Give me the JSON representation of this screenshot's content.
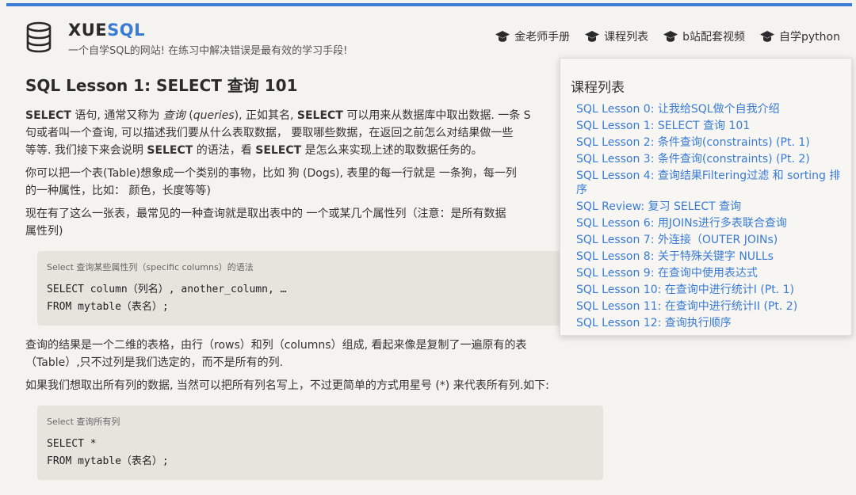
{
  "header": {
    "brand_part1": "XUE",
    "brand_part2": "SQL",
    "tagline": "一个自学SQL的网站! 在练习中解决错误是最有效的学习手段!",
    "nav": [
      {
        "label": "金老师手册",
        "icon": "graduation-cap-icon"
      },
      {
        "label": "课程列表",
        "icon": "graduation-cap-icon"
      },
      {
        "label": "b站配套视频",
        "icon": "graduation-cap-icon"
      },
      {
        "label": "自学python",
        "icon": "graduation-cap-icon"
      }
    ]
  },
  "colors": {
    "accent": "#3a7bd5",
    "background": "#f4f3ef",
    "code_bg": "#e6e4dd"
  },
  "lesson": {
    "title": "SQL Lesson 1: SELECT 查询 101",
    "p1": [
      {
        "t": "SELECT",
        "s": "b"
      },
      {
        "t": " 语句, 通常又称为 "
      },
      {
        "t": "查询",
        "s": "i"
      },
      {
        "t": " ("
      },
      {
        "t": "queries",
        "s": "i"
      },
      {
        "t": "), 正如其名, "
      },
      {
        "t": "SELECT",
        "s": "b"
      },
      {
        "t": " 可以用来从数据库中取出数据. 一条 S"
      },
      {
        "t": "",
        "s": "br"
      },
      {
        "t": "句或者叫一个查询, 可以描述我们要从什么表取数据， 要取哪些数据，在返回之前怎么对结果做一些"
      },
      {
        "t": "",
        "s": "br"
      },
      {
        "t": "等等. 我们接下来会说明 "
      },
      {
        "t": "SELECT",
        "s": "b"
      },
      {
        "t": " 的语法，看 "
      },
      {
        "t": "SELECT",
        "s": "b"
      },
      {
        "t": " 是怎么来实现上述的取数据任务的。"
      }
    ],
    "p2_line1": "你可以把一个表(Table)想象成一个类别的事物，比如 狗 (Dogs), 表里的每一行就是 一条狗，每一列",
    "p2_line2": "的一种属性，比如： 颜色，长度等等)",
    "p3_line1": "现在有了这么一张表，最常见的一种查询就是取出表中的 一个或某几个属性列（注意：是所有数据",
    "p3_line2": "属性列)",
    "code1": {
      "caption": "Select 查询某些属性列（specific columns）的语法",
      "line1": "SELECT column（列名）, another_column, …",
      "line2": "FROM mytable（表名）;"
    },
    "p4_line1": "查询的结果是一个二维的表格，由行（rows）和列（columns）组成, 看起来像是复制了一遍原有的表",
    "p4_line2": "（Table）,只不过列是我们选定的，而不是所有的列.",
    "p5": "如果我们想取出所有列的数据, 当然可以把所有列名写上，不过更简单的方式用星号 (*) 来代表所有列.如下:",
    "code2": {
      "caption": "Select 查询所有列",
      "line1": "SELECT *",
      "line2": "FROM mytable（表名）;"
    }
  },
  "dropdown": {
    "title": "课程列表",
    "items": [
      "SQL Lesson 0: 让我给SQL做个自我介绍",
      "SQL Lesson 1: SELECT 查询 101",
      "SQL Lesson 2: 条件查询(constraints) (Pt. 1)",
      "SQL Lesson 3: 条件查询(constraints) (Pt. 2)",
      "SQL Lesson 4: 查询结果Filtering过滤 和 sorting 排序",
      "SQL Review: 复习 SELECT 查询",
      "SQL Lesson 6: 用JOINs进行多表联合查询",
      "SQL Lesson 7: 外连接（OUTER JOINs)",
      "SQL Lesson 8: 关于特殊关键字 NULLs",
      "SQL Lesson 9: 在查询中使用表达式",
      "SQL Lesson 10: 在查询中进行统计I (Pt. 1)",
      "SQL Lesson 11: 在查询中进行统计II (Pt. 2)",
      "SQL Lesson 12: 查询执行顺序"
    ]
  }
}
